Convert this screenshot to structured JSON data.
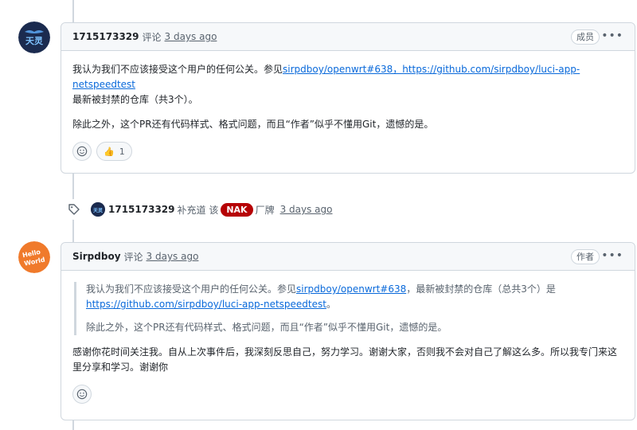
{
  "comments": [
    {
      "avatar": {
        "text": "天灵",
        "bg": "#1b2b4f"
      },
      "author": "1715173329",
      "action": "评论",
      "time": "3 days ago",
      "role": "成员",
      "body": {
        "p1_prefix": "我认为我们不应该接受这个用户的任何公关。参见",
        "p1_link1": "sirpdboy/openwrt#638，https://github.com/sirpdboy/luci-app-netspeedtest",
        "p1_suffix": "最新被封禁的仓库（共3个）。",
        "p2": "除此之外，这个PR还有代码样式、格式问题，而且“作者”似乎不懂用Git，遗憾的是。"
      },
      "reaction": {
        "emoji": "👍",
        "count": "1"
      }
    },
    {
      "avatar": {
        "text": "Hello World",
        "bg": "#f07a2b"
      },
      "author": "Sirpdboy",
      "action": "评论",
      "time": "3 days ago",
      "role": "作者",
      "quote": {
        "q1_prefix": "我认为我们不应该接受这个用户的任何公关。参见",
        "q1_link1": "sirpdboy/openwrt#638",
        "q1_mid": "，最新被封禁的仓库（总共3个）是",
        "q1_link2": "https://github.com/sirpdboy/luci-app-netspeedtest",
        "q1_end": "。",
        "q2": "除此之外，这个PR还有代码样式、格式问题，而且“作者”似乎不懂用Git，遗憾的是。"
      },
      "body": {
        "text": "感谢你花时间关注我。自从上次事件后，我深刻反思自己，努力学习。谢谢大家，否则我不会对自己了解这么多。所以我专门来这里分享和学习。谢谢你"
      }
    }
  ],
  "event": {
    "author": "1715173329",
    "text_before": "补充道 该",
    "label": "NAK",
    "label_color": "#b60205",
    "text_after": "厂牌",
    "time": "3 days ago"
  },
  "icons": {
    "smiley": "smiley-icon",
    "kebab": "kebab-horizontal-icon",
    "tag": "tag-icon"
  }
}
